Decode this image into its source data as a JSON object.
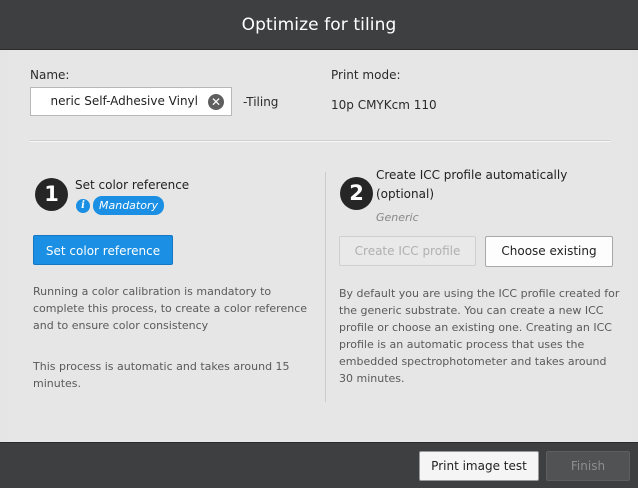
{
  "dialog": {
    "title": "Optimize for tiling"
  },
  "name_field": {
    "label": "Name:",
    "value": "neric Self-Adhesive Vinyl",
    "suffix": "-Tiling",
    "clear_glyph": "✕"
  },
  "print_mode": {
    "label": "Print mode:",
    "value": "10p CMYKcm 110"
  },
  "step1": {
    "number": "1",
    "title": "Set color reference",
    "info_glyph": "i",
    "badge": "Mandatory",
    "button": "Set color reference",
    "description": "Running a color calibration is mandatory to complete this process, to create a color reference and to ensure color consistency",
    "note": "This process is automatic and takes around 15 minutes."
  },
  "step2": {
    "number": "2",
    "title": "Create ICC profile automatically (optional)",
    "subtitle": "Generic",
    "create_button": "Create ICC profile",
    "choose_button": "Choose existing",
    "description": "By default you are using the ICC profile created for the generic substrate. You can create a new ICC profile or choose an existing one. Creating an ICC profile is an automatic process that uses the embedded spectrophotometer and takes around 30 minutes."
  },
  "footer": {
    "print_button": "Print image test",
    "finish_button": "Finish"
  },
  "colors": {
    "accent": "#1a8fe3",
    "titlebar": "#3d3f41",
    "panel": "#e6e6e6"
  },
  "icons": {
    "clear": "clear-icon",
    "info": "info-icon"
  }
}
